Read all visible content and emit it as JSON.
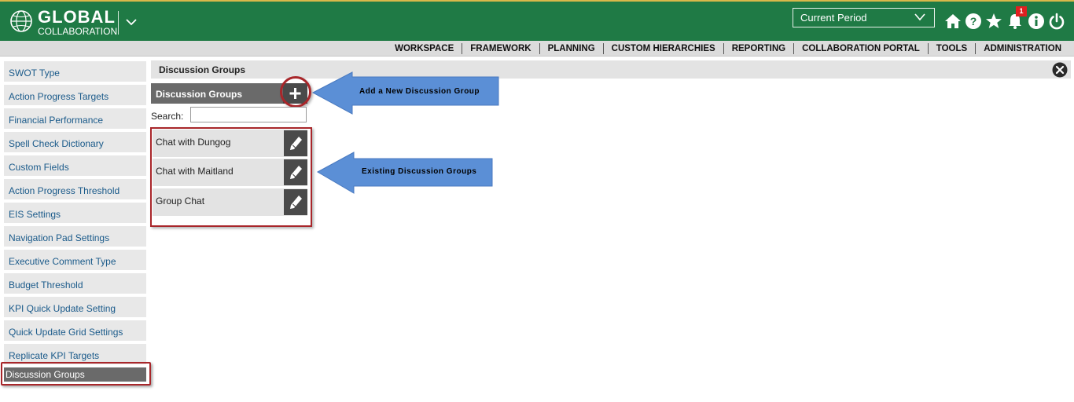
{
  "header": {
    "logo_main": "GLOBAL",
    "logo_sub": "COLLABORATION",
    "period_label": "Current Period",
    "notification_count": "1"
  },
  "nav": {
    "items": [
      "WORKSPACE",
      "FRAMEWORK",
      "PLANNING",
      "CUSTOM HIERARCHIES",
      "REPORTING",
      "COLLABORATION PORTAL",
      "TOOLS",
      "ADMINISTRATION"
    ]
  },
  "sidebar": {
    "items": [
      "SWOT Type",
      "Action Progress Targets",
      "Financial Performance",
      "Spell Check Dictionary",
      "Custom Fields",
      "Action Progress Threshold",
      "EIS Settings",
      "Navigation Pad Settings",
      "Executive Comment Type",
      "Budget Threshold",
      "KPI Quick Update Setting",
      "Quick Update Grid Settings",
      "Replicate KPI Targets",
      "Discussion Groups"
    ],
    "active_index": 13
  },
  "panel": {
    "title": "Discussion Groups",
    "list_title": "Discussion Groups",
    "search_label": "Search:",
    "search_value": "",
    "groups": [
      "Chat with Dungog",
      "Chat with Maitland",
      "Group Chat"
    ]
  },
  "callouts": {
    "add": "Add a New Discussion Group",
    "existing": "Existing Discussion Groups"
  },
  "colors": {
    "header_green": "#1f7a45",
    "highlight_red": "#a8262a",
    "callout_blue": "#5b8fd6"
  }
}
